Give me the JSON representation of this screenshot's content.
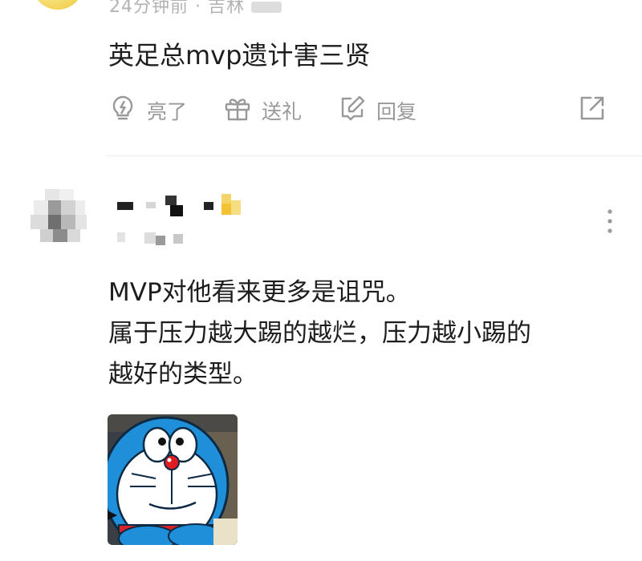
{
  "top_comment": {
    "meta_time": "24分钟前",
    "meta_location": "吉林",
    "text": "英足总mvp遗计害三贤"
  },
  "actions": {
    "like_label": "亮了",
    "gift_label": "送礼",
    "reply_label": "回复"
  },
  "icons": {
    "like": "lightbulb-icon",
    "gift": "gift-icon",
    "reply": "reply-edit-icon",
    "share": "share-icon",
    "more": "more-vertical-icon"
  },
  "second_comment": {
    "lines": [
      "MVP对他看来更多是诅咒。",
      "属于压力越大踢的越烂，压力越小踢的",
      "越好的类型。"
    ],
    "sticker": "doraemon-sticker"
  },
  "colors": {
    "text": "#1d1d1d",
    "muted": "#999999",
    "divider": "#ececec",
    "doraemon_blue": "#1e8fd8"
  }
}
